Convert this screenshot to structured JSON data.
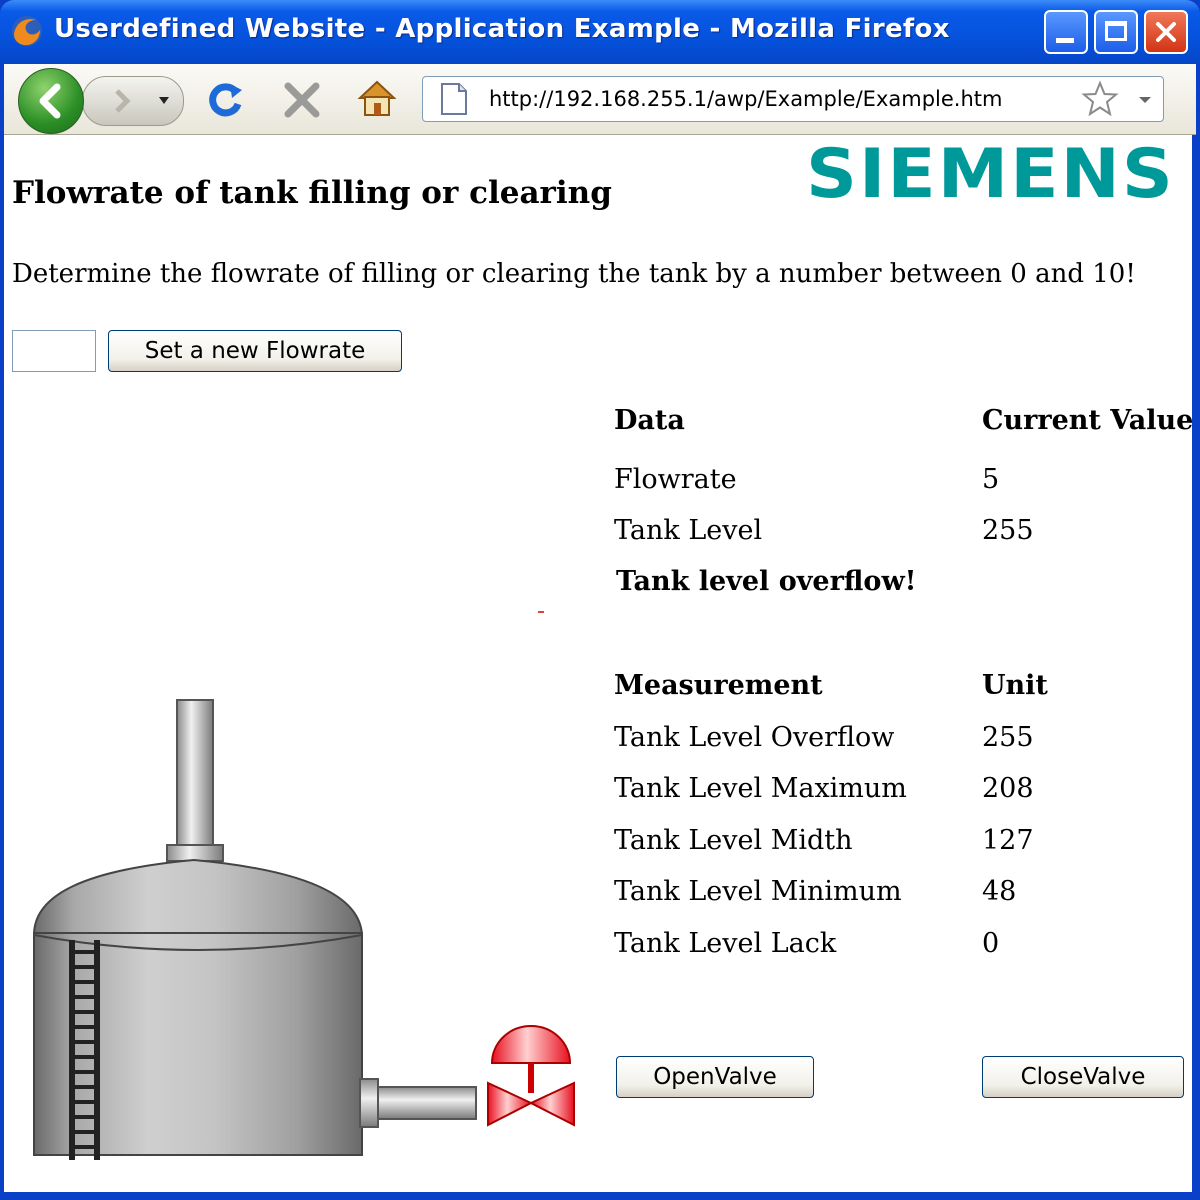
{
  "window": {
    "title": "Userdefined Website - Application Example - Mozilla Firefox"
  },
  "toolbar": {
    "url": "http://192.168.255.1/awp/Example/Example.htm"
  },
  "page": {
    "logo": "SIEMENS",
    "heading": "Flowrate of tank filling or clearing",
    "intro": "Determine the flowrate of filling or clearing the tank by a number between 0 and 10!",
    "flowrate_input_value": "",
    "set_button": "Set a new Flowrate",
    "data_table": {
      "header_data": "Data",
      "header_value": "Current Value",
      "rows": [
        {
          "label": "Flowrate",
          "value": "5"
        },
        {
          "label": "Tank Level",
          "value": "255"
        }
      ],
      "alert": "Tank level overflow!"
    },
    "measurement_table": {
      "header_measurement": "Measurement",
      "header_unit": "Unit",
      "rows": [
        {
          "label": "Tank Level Overflow",
          "value": "255"
        },
        {
          "label": "Tank Level Maximum",
          "value": "208"
        },
        {
          "label": "Tank Level Midth",
          "value": "127"
        },
        {
          "label": "Tank Level Minimum",
          "value": "48"
        },
        {
          "label": "Tank Level Lack",
          "value": "0"
        }
      ]
    },
    "open_valve": "OpenValve",
    "close_valve": "CloseValve"
  },
  "colors": {
    "logo": "#009999",
    "titlebar": "#0a5ae8",
    "valve": "#e8202a"
  }
}
